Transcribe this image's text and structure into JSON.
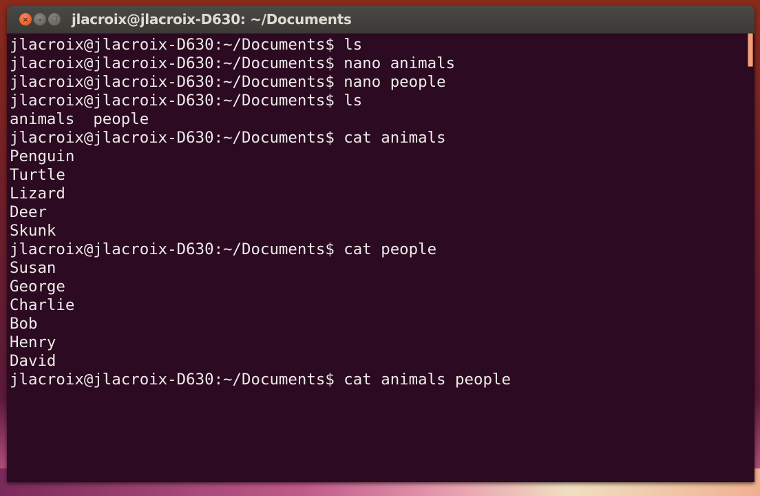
{
  "window": {
    "title": "jlacroix@jlacroix-D630: ~/Documents",
    "buttons": {
      "close": "×",
      "minimize": "–",
      "maximize": "□"
    }
  },
  "terminal": {
    "lines": [
      "jlacroix@jlacroix-D630:~/Documents$ ls",
      "jlacroix@jlacroix-D630:~/Documents$ nano animals",
      "jlacroix@jlacroix-D630:~/Documents$ nano people",
      "jlacroix@jlacroix-D630:~/Documents$ ls",
      "animals  people",
      "jlacroix@jlacroix-D630:~/Documents$ cat animals",
      "Penguin",
      "Turtle",
      "Lizard",
      "Deer",
      "Skunk",
      "jlacroix@jlacroix-D630:~/Documents$ cat people",
      "Susan",
      "George",
      "Charlie",
      "Bob",
      "Henry",
      "David",
      "jlacroix@jlacroix-D630:~/Documents$ cat animals people"
    ]
  }
}
